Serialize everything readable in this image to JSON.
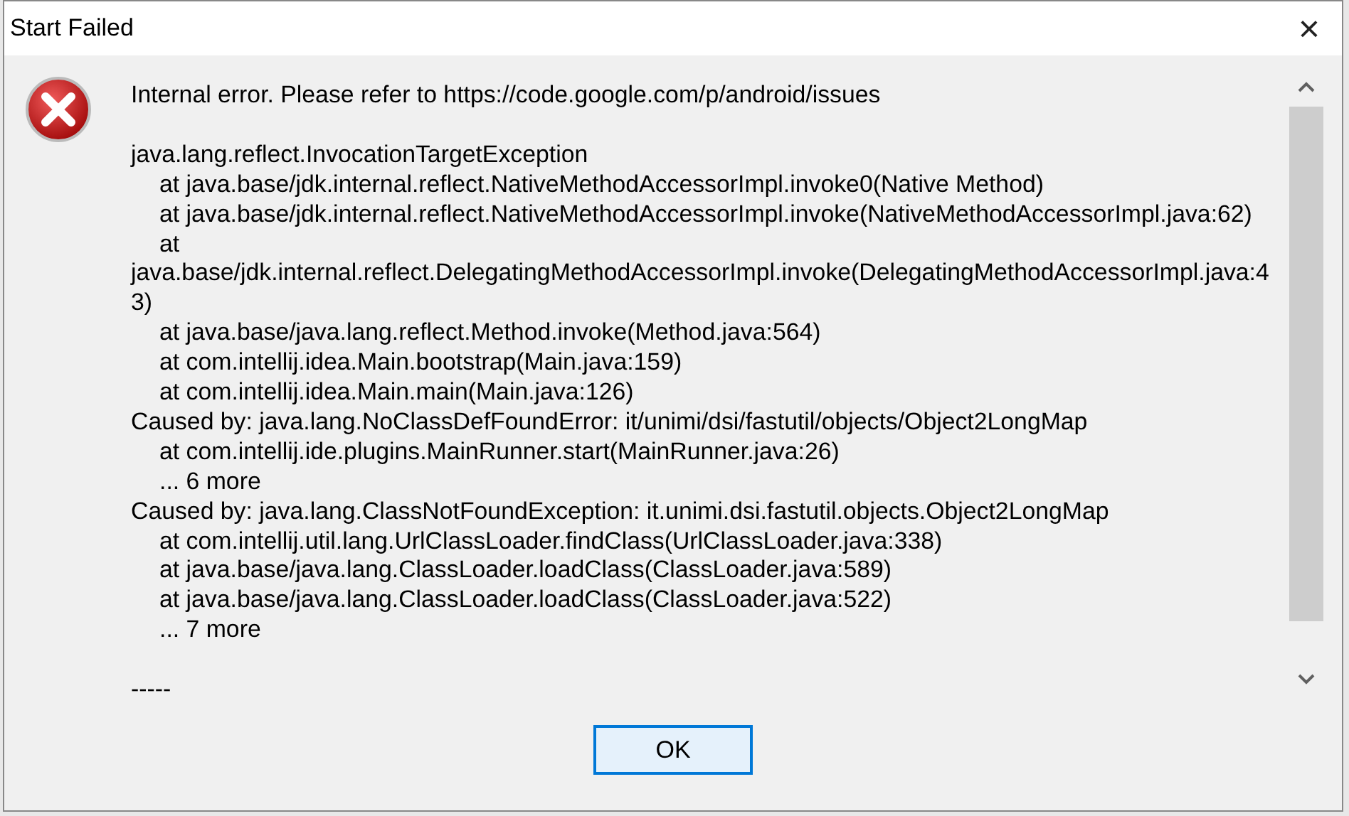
{
  "window": {
    "title": "Start Failed",
    "close": "×"
  },
  "message": {
    "paragraphs": [
      {
        "lines": [
          {
            "kind": "text",
            "text": "Internal error. Please refer to https://code.google.com/p/android/issues"
          }
        ]
      },
      {
        "lines": [
          {
            "kind": "text",
            "text": "java.lang.reflect.InvocationTargetException"
          },
          {
            "kind": "frame",
            "text": "at java.base/jdk.internal.reflect.NativeMethodAccessorImpl.invoke0(Native Method)"
          },
          {
            "kind": "frame",
            "text": "at java.base/jdk.internal.reflect.NativeMethodAccessorImpl.invoke(NativeMethodAccessorImpl.java:62)"
          },
          {
            "kind": "frame",
            "text": "at"
          },
          {
            "kind": "text",
            "text": "java.base/jdk.internal.reflect.DelegatingMethodAccessorImpl.invoke(DelegatingMethodAccessorImpl.java:4"
          },
          {
            "kind": "text",
            "text": "3)"
          },
          {
            "kind": "frame",
            "text": "at java.base/java.lang.reflect.Method.invoke(Method.java:564)"
          },
          {
            "kind": "frame",
            "text": "at com.intellij.idea.Main.bootstrap(Main.java:159)"
          },
          {
            "kind": "frame",
            "text": "at com.intellij.idea.Main.main(Main.java:126)"
          },
          {
            "kind": "text",
            "text": "Caused by: java.lang.NoClassDefFoundError: it/unimi/dsi/fastutil/objects/Object2LongMap"
          },
          {
            "kind": "frame",
            "text": "at com.intellij.ide.plugins.MainRunner.start(MainRunner.java:26)"
          },
          {
            "kind": "frame",
            "text": "... 6 more"
          },
          {
            "kind": "text",
            "text": "Caused by: java.lang.ClassNotFoundException: it.unimi.dsi.fastutil.objects.Object2LongMap"
          },
          {
            "kind": "frame",
            "text": "at com.intellij.util.lang.UrlClassLoader.findClass(UrlClassLoader.java:338)"
          },
          {
            "kind": "frame",
            "text": "at java.base/java.lang.ClassLoader.loadClass(ClassLoader.java:589)"
          },
          {
            "kind": "frame",
            "text": "at java.base/java.lang.ClassLoader.loadClass(ClassLoader.java:522)"
          },
          {
            "kind": "frame",
            "text": "... 7 more"
          }
        ]
      },
      {
        "lines": [
          {
            "kind": "text",
            "text": "-----"
          }
        ]
      }
    ]
  },
  "buttons": [
    {
      "label": "OK",
      "selected": true
    }
  ]
}
